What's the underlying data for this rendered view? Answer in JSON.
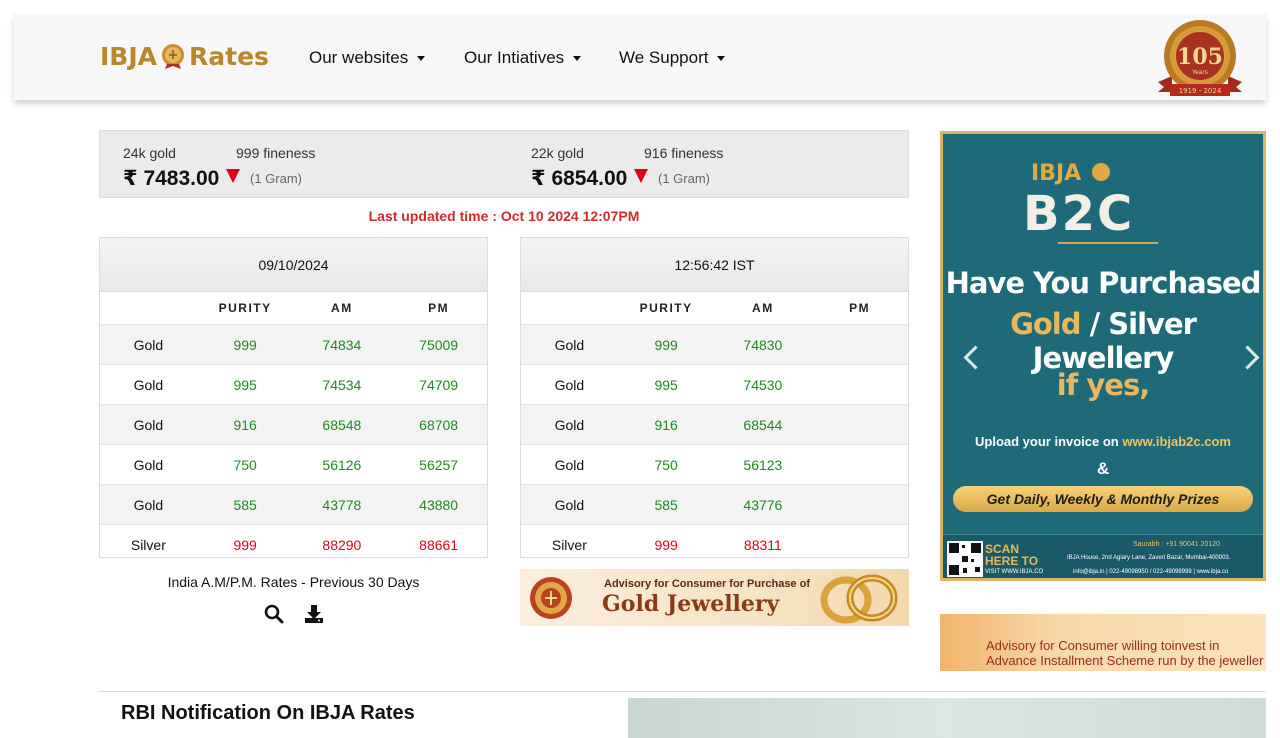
{
  "navbar": {
    "brand_left": "IBJA",
    "brand_right": "Rates",
    "menu": [
      {
        "label": "Our websites"
      },
      {
        "label": "Our Intiatives"
      },
      {
        "label": "We Support"
      }
    ],
    "badge": {
      "number": "105",
      "years": "Years",
      "span": "1919 - 2024"
    }
  },
  "prices": {
    "gold24": {
      "karat": "24k gold",
      "fineness": "999 fineness",
      "value": "₹ 7483.00",
      "unit": "(1 Gram)",
      "trend": "down"
    },
    "gold22": {
      "karat": "22k gold",
      "fineness": "916 fineness",
      "value": "₹ 6854.00",
      "unit": "(1 Gram)",
      "trend": "down"
    }
  },
  "last_updated": "Last updated time : Oct 10 2024 12:07PM",
  "columns": {
    "purity": "PURITY",
    "am": "AM",
    "pm": "PM"
  },
  "table_left": {
    "header": "09/10/2024",
    "rows": [
      {
        "metal": "Gold",
        "purity": "999",
        "am": "74834",
        "pm": "75009",
        "color": "green"
      },
      {
        "metal": "Gold",
        "purity": "995",
        "am": "74534",
        "pm": "74709",
        "color": "green"
      },
      {
        "metal": "Gold",
        "purity": "916",
        "am": "68548",
        "pm": "68708",
        "color": "green"
      },
      {
        "metal": "Gold",
        "purity": "750",
        "am": "56126",
        "pm": "56257",
        "color": "green"
      },
      {
        "metal": "Gold",
        "purity": "585",
        "am": "43778",
        "pm": "43880",
        "color": "green"
      },
      {
        "metal": "Silver",
        "purity": "999",
        "am": "88290",
        "pm": "88661",
        "color": "red"
      }
    ]
  },
  "table_right": {
    "header": "12:56:42 IST",
    "rows": [
      {
        "metal": "Gold",
        "purity": "999",
        "am": "74830",
        "pm": "",
        "color": "green"
      },
      {
        "metal": "Gold",
        "purity": "995",
        "am": "74530",
        "pm": "",
        "color": "green"
      },
      {
        "metal": "Gold",
        "purity": "916",
        "am": "68544",
        "pm": "",
        "color": "green"
      },
      {
        "metal": "Gold",
        "purity": "750",
        "am": "56123",
        "pm": "",
        "color": "green"
      },
      {
        "metal": "Gold",
        "purity": "585",
        "am": "43776",
        "pm": "",
        "color": "green"
      },
      {
        "metal": "Silver",
        "purity": "999",
        "am": "88311",
        "pm": "",
        "color": "red"
      }
    ]
  },
  "previous_days": "India A.M/P.M. Rates - Previous 30 Days",
  "tools": [
    {
      "icon": "search-icon"
    },
    {
      "icon": "download-icon"
    }
  ],
  "advisory_gold": {
    "line1": "Advisory for Consumer for Purchase of",
    "line2": "Gold Jewellery"
  },
  "advisory_installment": {
    "line1": "Advisory for Consumer willing toinvest in",
    "line2": "Advance Installment Scheme run by the jeweller"
  },
  "carousel": {
    "logo_top": "IBJA",
    "logo_main": "B2C",
    "heading1": "Have You Purchased",
    "heading2_gold": "Gold",
    "heading2_rest": " / Silver Jewellery",
    "heading3": "if yes,",
    "upload_text": "Upload your invoice on ",
    "upload_url": "www.ibjab2c.com",
    "amp": "&",
    "prize": "Get Daily, Weekly & Monthly Prizes",
    "scan": "SCAN",
    "here_to": "HERE TO",
    "visit": "VISIT WWW.IBJA.CO",
    "saurabh": "Saurabh : +91 90041 20120",
    "address": "IBJA House, 2nd Agiary Lane, Zaveri Bazar, Mumbai-400003.",
    "contacts": "info@ibja.in  |  022-49098950 / 022-49098999  |  www.ibja.co"
  },
  "rbi_title": "RBI Notification On IBJA Rates",
  "colors": {
    "green": "#1f8a1f",
    "red": "#e3001b",
    "gold": "#b9872f",
    "carousel_bg": "#1e6a79"
  }
}
